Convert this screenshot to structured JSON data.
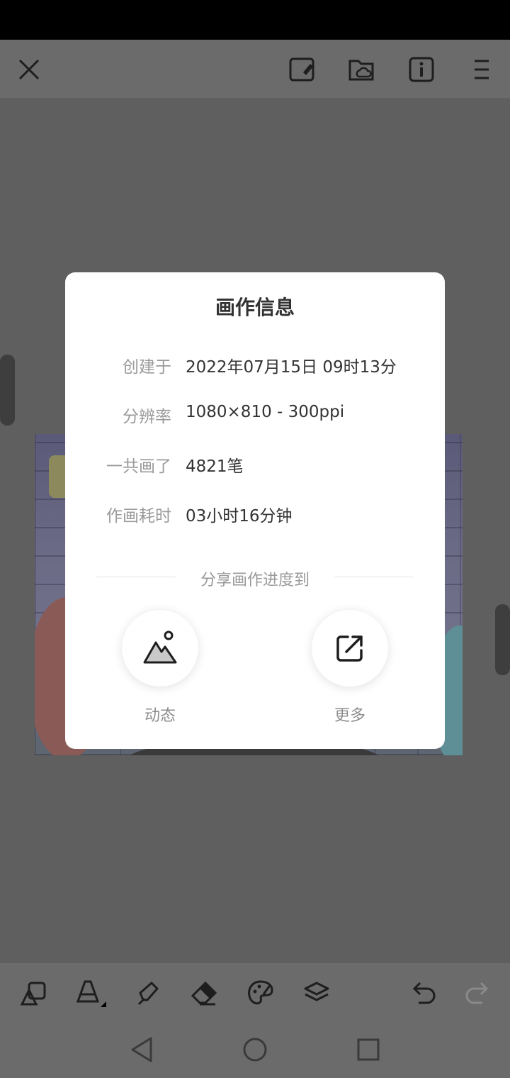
{
  "dialog": {
    "title": "画作信息",
    "rows": [
      {
        "label": "创建于",
        "value": "2022年07月15日 09时13分"
      },
      {
        "label": "分辨率",
        "value": "1080×810 - 300ppi"
      },
      {
        "label": "一共画了",
        "value": "4821笔"
      },
      {
        "label": "作画耗时",
        "value": "03小时16分钟"
      }
    ],
    "share_caption": "分享画作进度到",
    "share_targets": [
      {
        "label": "动态",
        "icon": "mountain-image-icon"
      },
      {
        "label": "更多",
        "icon": "external-share-icon"
      }
    ]
  },
  "top_bar_icons": [
    "close-icon",
    "canvas-edit-icon",
    "cloud-folder-icon",
    "info-icon",
    "menu-icon"
  ],
  "toolbar_icons": [
    "shapes-icon",
    "brush-cone-icon",
    "pen-nib-icon",
    "eraser-icon",
    "palette-icon",
    "layers-icon",
    "undo-icon",
    "redo-icon"
  ],
  "nav_icons": [
    "back-icon",
    "home-icon",
    "recents-icon"
  ]
}
